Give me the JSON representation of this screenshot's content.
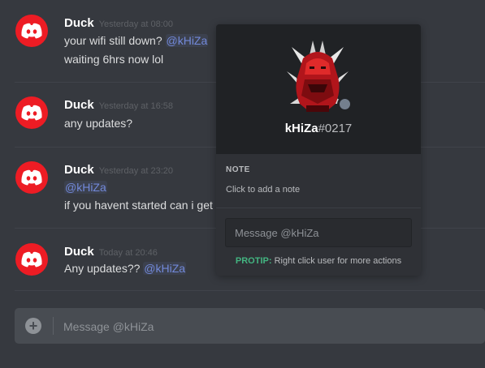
{
  "messages": [
    {
      "author": "Duck",
      "timestamp": "Yesterday at 08:00",
      "lines": [
        {
          "pre": "your wifi still down?",
          "mention": "@kHiZa"
        },
        {
          "pre": "waiting 6hrs now lol"
        }
      ]
    },
    {
      "author": "Duck",
      "timestamp": "Yesterday at 16:58",
      "lines": [
        {
          "pre": "any updates?"
        }
      ]
    },
    {
      "author": "Duck",
      "timestamp": "Yesterday at 23:20",
      "lines": [
        {
          "mention": "@kHiZa"
        },
        {
          "pre": "if you havent started can i get"
        }
      ]
    },
    {
      "author": "Duck",
      "timestamp": "Today at 20:46",
      "lines": [
        {
          "pre": "Any updates??",
          "mention": "@kHiZa"
        }
      ]
    }
  ],
  "composer": {
    "placeholder": "Message @kHiZa",
    "add_icon": "plus-circle-icon"
  },
  "profile": {
    "username": "kHiZa",
    "discriminator": "#0217",
    "status": "offline",
    "status_color": "#747f8d",
    "note_title": "NOTE",
    "note_placeholder": "Click to add a note",
    "message_placeholder": "Message @kHiZa",
    "protip_label": "PROTIP:",
    "protip_text": " Right click user for more actions"
  },
  "colors": {
    "background": "#36393f",
    "avatar_red": "#ed1c24",
    "mention": "#7289da",
    "protip": "#43b581",
    "popout_header": "#202225"
  }
}
